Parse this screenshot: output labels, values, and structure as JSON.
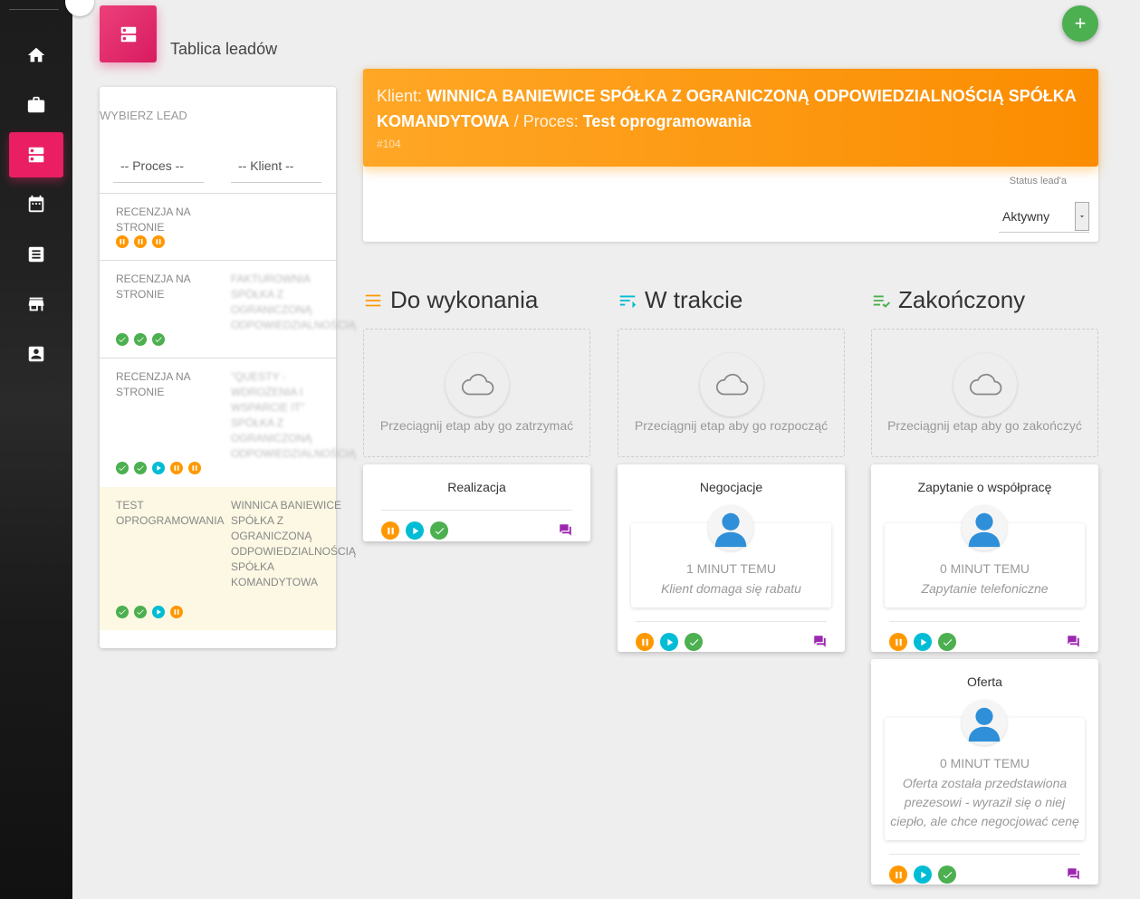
{
  "page": {
    "title": "Tablica leadów"
  },
  "sidebar": {
    "items": [
      {
        "icon": "home-icon",
        "active": false
      },
      {
        "icon": "briefcase-icon",
        "active": false
      },
      {
        "icon": "dns-icon",
        "active": true
      },
      {
        "icon": "calendar-icon",
        "active": false
      },
      {
        "icon": "list-icon",
        "active": false
      },
      {
        "icon": "store-icon",
        "active": false
      },
      {
        "icon": "contact-icon",
        "active": false
      }
    ]
  },
  "lead_panel": {
    "title": "WYBIERZ LEAD",
    "filter_process": "-- Proces --",
    "filter_client": "-- Klient --",
    "leads": [
      {
        "process": "RECENZJA NA STRONIE",
        "client": "",
        "statuses": [
          "pause",
          "pause",
          "pause"
        ]
      },
      {
        "process": "RECENZJA NA STRONIE",
        "client": "FAKTUROWNIA SPÓŁKA Z OGRANICZONĄ ODPOWIEDZIALNOŚCIĄ",
        "statuses": [
          "check",
          "check",
          "check"
        ]
      },
      {
        "process": "RECENZJA NA STRONIE",
        "client": "\"QUESTY - WDROŻENIA I WSPARCIE IT\" SPÓŁKA Z OGRANICZONĄ ODPOWIEDZIALNOŚCIĄ",
        "statuses": [
          "check",
          "check",
          "play",
          "pause",
          "pause"
        ]
      },
      {
        "process": "TEST OPROGRAMOWANIA",
        "client": "WINNICA BANIEWICE SPÓŁKA Z OGRANICZONĄ ODPOWIEDZIALNOŚCIĄ SPÓŁKA KOMANDYTOWA",
        "statuses": [
          "check",
          "check",
          "play",
          "pause"
        ]
      }
    ]
  },
  "client_header": {
    "client_label": "Klient:",
    "client_name": "WINNICA BANIEWICE SPÓŁKA Z OGRANICZONĄ ODPOWIEDZIALNOŚCIĄ SPÓŁKA KOMANDYTOWA",
    "separator": "/",
    "process_label": "Proces:",
    "process_name": "Test oprogramowania",
    "lead_number": "#104",
    "status_label": "Status lead'a",
    "status_value": "Aktywny"
  },
  "columns": [
    {
      "title": "Do wykonania",
      "icon": "list-lines-icon",
      "icon_color": "#ff9800",
      "dropzone_hint": "Przeciągnij etap aby go zatrzymać",
      "cards": [
        {
          "title": "Realizacja"
        }
      ]
    },
    {
      "title": "W trakcie",
      "icon": "sort-icon",
      "icon_color": "#00bcd4",
      "dropzone_hint": "Przeciągnij etap aby go rozpocząć",
      "cards": [
        {
          "title": "Negocjacje",
          "time": "1 MINUT TEMU",
          "desc": "Klient domaga się rabatu"
        }
      ]
    },
    {
      "title": "Zakończony",
      "icon": "playlist-check-icon",
      "icon_color": "#4caf50",
      "dropzone_hint": "Przeciągnij etap aby go zakończyć",
      "cards": [
        {
          "title": "Zapytanie o współpracę",
          "time": "0 MINUT TEMU",
          "desc": "Zapytanie telefoniczne"
        },
        {
          "title": "Oferta",
          "time": "0 MINUT TEMU",
          "desc": "Oferta została przedstawiona prezesowi - wyraził się o niej ciepło, ale chce negocjować cenę"
        }
      ]
    }
  ],
  "colors": {
    "accent": "#e91e63",
    "orange": "#ff9800",
    "cyan": "#00bcd4",
    "green": "#4caf50",
    "purple": "#9c27b0"
  }
}
